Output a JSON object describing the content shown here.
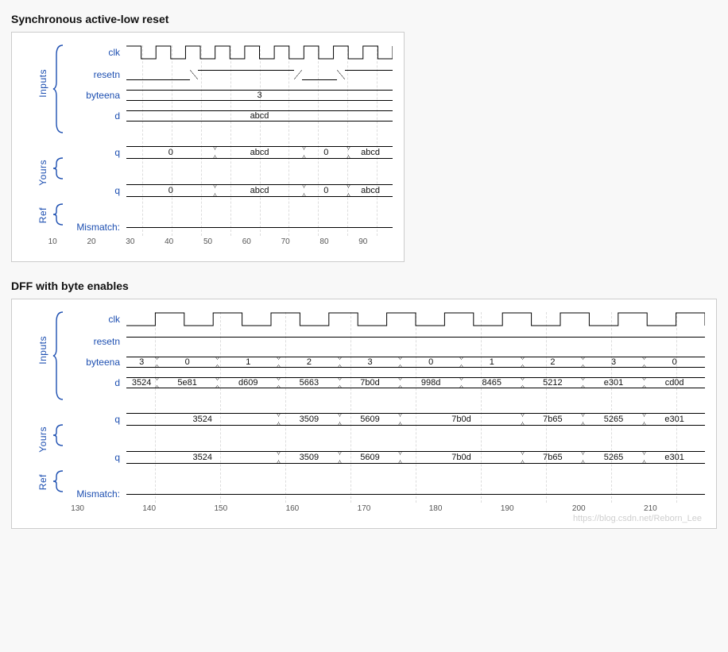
{
  "panels": [
    {
      "title": "Synchronous active-low reset",
      "groups": {
        "inputs": "Inputs",
        "yours": "Yours",
        "ref": "Ref"
      },
      "signals": {
        "clk": "clk",
        "resetn": "resetn",
        "byteena": "byteena",
        "d": "d",
        "q_yours": "q",
        "q_ref": "q",
        "mismatch": "Mismatch:"
      },
      "byteena_value": "3",
      "d_value": "abcd",
      "q_segments": [
        "0",
        "abcd",
        "0",
        "abcd"
      ],
      "axis_ticks": [
        "10",
        "20",
        "30",
        "40",
        "50",
        "60",
        "70",
        "80",
        "90"
      ]
    },
    {
      "title": "DFF with byte enables",
      "groups": {
        "inputs": "Inputs",
        "yours": "Yours",
        "ref": "Ref"
      },
      "signals": {
        "clk": "clk",
        "resetn": "resetn",
        "byteena": "byteena",
        "d": "d",
        "q_yours": "q",
        "q_ref": "q",
        "mismatch": "Mismatch:"
      },
      "byteena_segments": [
        "3",
        "0",
        "1",
        "2",
        "3",
        "0",
        "1",
        "2",
        "3",
        "0"
      ],
      "d_segments": [
        "3524",
        "5e81",
        "d609",
        "5663",
        "7b0d",
        "998d",
        "8465",
        "5212",
        "e301",
        "cd0d"
      ],
      "q_segments": [
        "3524",
        "3509",
        "5609",
        "7b0d",
        "7b65",
        "5265",
        "e301"
      ],
      "axis_ticks": [
        "130",
        "140",
        "150",
        "160",
        "170",
        "180",
        "190",
        "200",
        "210"
      ]
    }
  ],
  "watermark": "https://blog.csdn.net/Reborn_Lee",
  "chart_data": [
    {
      "type": "timing-diagram",
      "title": "Synchronous active-low reset",
      "time_axis": [
        10,
        20,
        30,
        40,
        50,
        60,
        70,
        80,
        90
      ],
      "signals": {
        "clk": {
          "kind": "clock",
          "period": 10
        },
        "resetn": {
          "kind": "bit",
          "segments": [
            [
              "low",
              5,
              27
            ],
            [
              "high",
              27,
              62
            ],
            [
              "low",
              62,
              77
            ],
            [
              "high",
              77,
              95
            ]
          ]
        },
        "byteena": {
          "kind": "bus",
          "value": "3"
        },
        "d": {
          "kind": "bus",
          "value": "abcd"
        },
        "q_yours": {
          "kind": "bus",
          "segments": [
            [
              "0",
              5,
              35
            ],
            [
              "abcd",
              35,
              65
            ],
            [
              "0",
              65,
              80
            ],
            [
              "abcd",
              80,
              95
            ]
          ]
        },
        "q_ref": {
          "kind": "bus",
          "segments": [
            [
              "0",
              5,
              35
            ],
            [
              "abcd",
              35,
              65
            ],
            [
              "0",
              65,
              80
            ],
            [
              "abcd",
              80,
              95
            ]
          ]
        },
        "mismatch": {
          "kind": "bit",
          "constant": "low"
        }
      }
    },
    {
      "type": "timing-diagram",
      "title": "DFF with byte enables",
      "time_axis": [
        130,
        140,
        150,
        160,
        170,
        180,
        190,
        200,
        210
      ],
      "signals": {
        "clk": {
          "kind": "clock",
          "period": 10
        },
        "resetn": {
          "kind": "bit",
          "constant": "high"
        },
        "byteena": {
          "kind": "bus",
          "segments": [
            "3",
            "0",
            "1",
            "2",
            "3",
            "0",
            "1",
            "2",
            "3",
            "0"
          ]
        },
        "d": {
          "kind": "bus",
          "segments": [
            "3524",
            "5e81",
            "d609",
            "5663",
            "7b0d",
            "998d",
            "8465",
            "5212",
            "e301",
            "cd0d"
          ]
        },
        "q_yours": {
          "kind": "bus",
          "segments": [
            [
              "3524",
              125,
              150
            ],
            [
              "3509",
              150,
              160
            ],
            [
              "5609",
              160,
              170
            ],
            [
              "7b0d",
              170,
              190
            ],
            [
              "7b65",
              190,
              200
            ],
            [
              "5265",
              200,
              210
            ],
            [
              "e301",
              210,
              220
            ]
          ]
        },
        "q_ref": {
          "kind": "bus",
          "segments": [
            [
              "3524",
              125,
              150
            ],
            [
              "3509",
              150,
              160
            ],
            [
              "5609",
              160,
              170
            ],
            [
              "7b0d",
              170,
              190
            ],
            [
              "7b65",
              190,
              200
            ],
            [
              "5265",
              200,
              210
            ],
            [
              "e301",
              210,
              220
            ]
          ]
        },
        "mismatch": {
          "kind": "bit",
          "constant": "low"
        }
      }
    }
  ]
}
